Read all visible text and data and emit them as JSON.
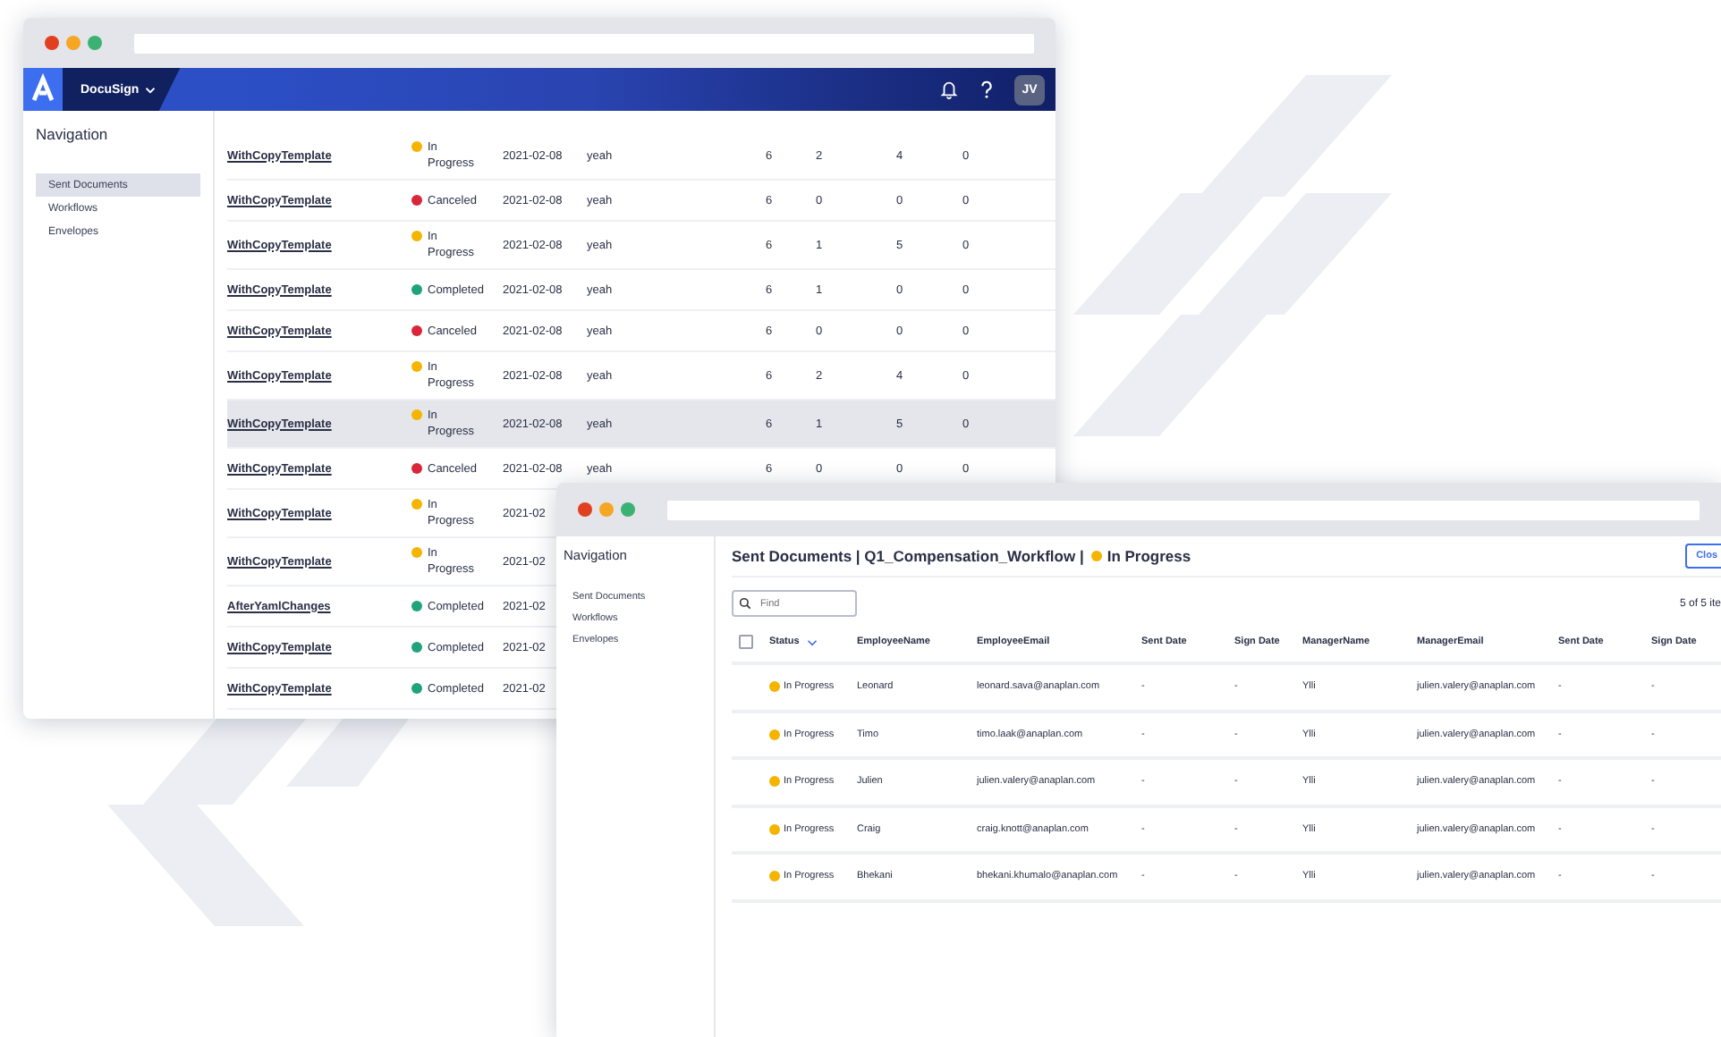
{
  "back_window": {
    "app_header": {
      "brand": "DocuSign",
      "avatar": "JV"
    },
    "navigation": {
      "title": "Navigation",
      "items": [
        {
          "label": "Sent Documents",
          "selected": true
        },
        {
          "label": "Workflows",
          "selected": false
        },
        {
          "label": "Envelopes",
          "selected": false
        }
      ]
    },
    "table": {
      "rows": [
        {
          "name": "WithCopyTemplate",
          "status": "In Progress",
          "color": "#f5b400",
          "date": "2021-02-08",
          "note": "yeah",
          "values": [
            "6",
            "2",
            "4",
            "0"
          ],
          "highlighted": false
        },
        {
          "name": "WithCopyTemplate",
          "status": "Canceled",
          "color": "#d9263a",
          "date": "2021-02-08",
          "note": "yeah",
          "values": [
            "6",
            "0",
            "0",
            "0"
          ],
          "highlighted": false
        },
        {
          "name": "WithCopyTemplate",
          "status": "In Progress",
          "color": "#f5b400",
          "date": "2021-02-08",
          "note": "yeah",
          "values": [
            "6",
            "1",
            "5",
            "0"
          ],
          "highlighted": false
        },
        {
          "name": "WithCopyTemplate",
          "status": "Completed",
          "color": "#1fa37a",
          "date": "2021-02-08",
          "note": "yeah",
          "values": [
            "6",
            "1",
            "0",
            "0"
          ],
          "highlighted": false
        },
        {
          "name": "WithCopyTemplate",
          "status": "Canceled",
          "color": "#d9263a",
          "date": "2021-02-08",
          "note": "yeah",
          "values": [
            "6",
            "0",
            "0",
            "0"
          ],
          "highlighted": false
        },
        {
          "name": "WithCopyTemplate",
          "status": "In Progress",
          "color": "#f5b400",
          "date": "2021-02-08",
          "note": "yeah",
          "values": [
            "6",
            "2",
            "4",
            "0"
          ],
          "highlighted": false
        },
        {
          "name": "WithCopyTemplate",
          "status": "In Progress",
          "color": "#f5b400",
          "date": "2021-02-08",
          "note": "yeah",
          "values": [
            "6",
            "1",
            "5",
            "0"
          ],
          "highlighted": true
        },
        {
          "name": "WithCopyTemplate",
          "status": "Canceled",
          "color": "#d9263a",
          "date": "2021-02-08",
          "note": "yeah",
          "values": [
            "6",
            "0",
            "0",
            "0"
          ],
          "highlighted": false
        },
        {
          "name": "WithCopyTemplate",
          "status": "In Progress",
          "color": "#f5b400",
          "date": "2021-02",
          "highlighted": false
        },
        {
          "name": "WithCopyTemplate",
          "status": "In Progress",
          "color": "#f5b400",
          "date": "2021-02",
          "highlighted": false
        },
        {
          "name": "AfterYamlChanges",
          "status": "Completed",
          "color": "#1fa37a",
          "date": "2021-02",
          "highlighted": false
        },
        {
          "name": "WithCopyTemplate",
          "status": "Completed",
          "color": "#1fa37a",
          "date": "2021-02",
          "highlighted": false
        },
        {
          "name": "WithCopyTemplate",
          "status": "Completed",
          "color": "#1fa37a",
          "date": "2021-02",
          "highlighted": false
        }
      ]
    }
  },
  "front_window": {
    "navigation": {
      "title": "Navigation",
      "items": [
        {
          "label": "Sent Documents",
          "selected": false
        },
        {
          "label": "Workflows",
          "selected": false
        },
        {
          "label": "Envelopes",
          "selected": false
        }
      ]
    },
    "breadcrumb": "Sent Documents | Q1_Compensation_Workflow |",
    "status": {
      "label": "In Progress",
      "color": "#f5b400"
    },
    "close_button": "Clos",
    "search": {
      "placeholder": "Find"
    },
    "count": "5 of 5 ite",
    "table": {
      "select_all": {
        "checked": false
      },
      "columns": [
        {
          "label": "Status",
          "sortable": true
        },
        {
          "label": "EmployeeName",
          "sortable": false
        },
        {
          "label": "EmployeeEmail",
          "sortable": false
        },
        {
          "label": "Sent Date",
          "sortable": false
        },
        {
          "label": "Sign Date",
          "sortable": false
        },
        {
          "label": "ManagerName",
          "sortable": false
        },
        {
          "label": "ManagerEmail",
          "sortable": false
        },
        {
          "label": "Sent Date",
          "sortable": false
        },
        {
          "label": "Sign Date",
          "sortable": false
        }
      ],
      "rows": [
        {
          "color": "#f5b400",
          "cells": [
            "In Progress",
            "Leonard",
            "leonard.sava@anaplan.com",
            "-",
            "-",
            "Ylli",
            "julien.valery@anaplan.com",
            "-",
            "-"
          ]
        },
        {
          "color": "#f5b400",
          "cells": [
            "In Progress",
            "Timo",
            "timo.laak@anaplan.com",
            "-",
            "-",
            "Ylli",
            "julien.valery@anaplan.com",
            "-",
            "-"
          ]
        },
        {
          "color": "#f5b400",
          "cells": [
            "In Progress",
            "Julien",
            "julien.valery@anaplan.com",
            "-",
            "-",
            "Ylli",
            "julien.valery@anaplan.com",
            "-",
            "-"
          ]
        },
        {
          "color": "#f5b400",
          "cells": [
            "In Progress",
            "Craig",
            "craig.knott@anaplan.com",
            "-",
            "-",
            "Ylli",
            "julien.valery@anaplan.com",
            "-",
            "-"
          ]
        },
        {
          "color": "#f5b400",
          "cells": [
            "In Progress",
            "Bhekani",
            "bhekani.khumalo@anaplan.com",
            "-",
            "-",
            "Ylli",
            "julien.valery@anaplan.com",
            "-",
            "-"
          ]
        }
      ]
    }
  }
}
